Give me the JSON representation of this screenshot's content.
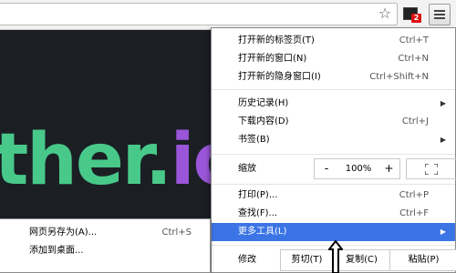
{
  "menu": {
    "items": [
      {
        "label": "打开新的标签页(T)",
        "shortcut": "Ctrl+T"
      },
      {
        "label": "打开新的窗口(N)",
        "shortcut": "Ctrl+N"
      },
      {
        "label": "打开新的隐身窗口(I)",
        "shortcut": "Ctrl+Shift+N"
      },
      {
        "label": "历史记录(H)",
        "shortcut": ""
      },
      {
        "label": "下载内容(D)",
        "shortcut": "Ctrl+J"
      },
      {
        "label": "书签(B)",
        "shortcut": ""
      },
      {
        "label": "打印(P)...",
        "shortcut": "Ctrl+P"
      },
      {
        "label": "查找(F)...",
        "shortcut": "Ctrl+F"
      },
      {
        "label": "更多工具(L)",
        "shortcut": ""
      }
    ],
    "zoom": {
      "label": "缩放",
      "minus": "-",
      "value": "100%",
      "plus": "+"
    },
    "edit": {
      "label": "修改",
      "cut": "剪切(T)",
      "copy": "复制(C)",
      "paste": "粘贴(P)"
    },
    "highlight_color": "#3b75e5"
  },
  "submenu": {
    "items": [
      {
        "label": "网页另存为(A)...",
        "shortcut": "Ctrl+S"
      },
      {
        "label": "添加到桌面...",
        "shortcut": ""
      },
      {
        "label": "",
        "shortcut": ""
      }
    ]
  },
  "page": {
    "big_text_green": "ther.",
    "big_text_purple": "io"
  },
  "toolbar": {
    "extension_badge": "2"
  }
}
